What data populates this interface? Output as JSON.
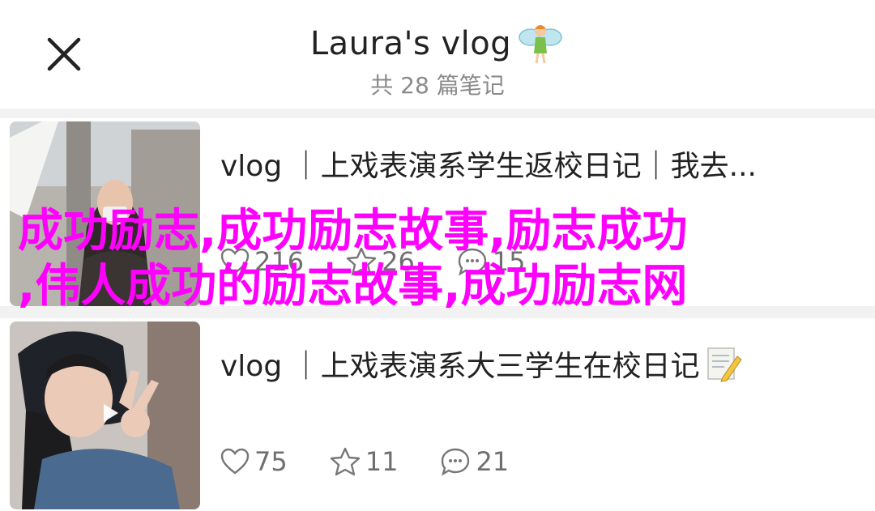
{
  "header": {
    "title": "Laura's vlog",
    "subtitle": "共 28 篇笔记"
  },
  "notes": [
    {
      "title": "vlog ｜上戏表演系学生返校日记｜我去...",
      "likes": "216",
      "collects": "26",
      "comments": "15"
    },
    {
      "title": "vlog ｜上戏表演系大三学生在校日记",
      "likes": "75",
      "collects": "11",
      "comments": "21"
    }
  ],
  "overlay": {
    "line1": "成功励志,成功励志故事,励志成功",
    "line2": ",伟人成功的励志故事,成功励志网"
  },
  "icons": {
    "close": "close-icon",
    "fairy": "fairy-emoji-icon",
    "memo": "memo-pencil-icon",
    "like": "heart-icon",
    "collect": "star-icon",
    "comment": "chat-bubble-icon",
    "play": "play-icon"
  },
  "colors": {
    "overlay_text": "#ff00ff",
    "header_bg": "#ffffff",
    "page_bg": "#f2f2f2"
  }
}
